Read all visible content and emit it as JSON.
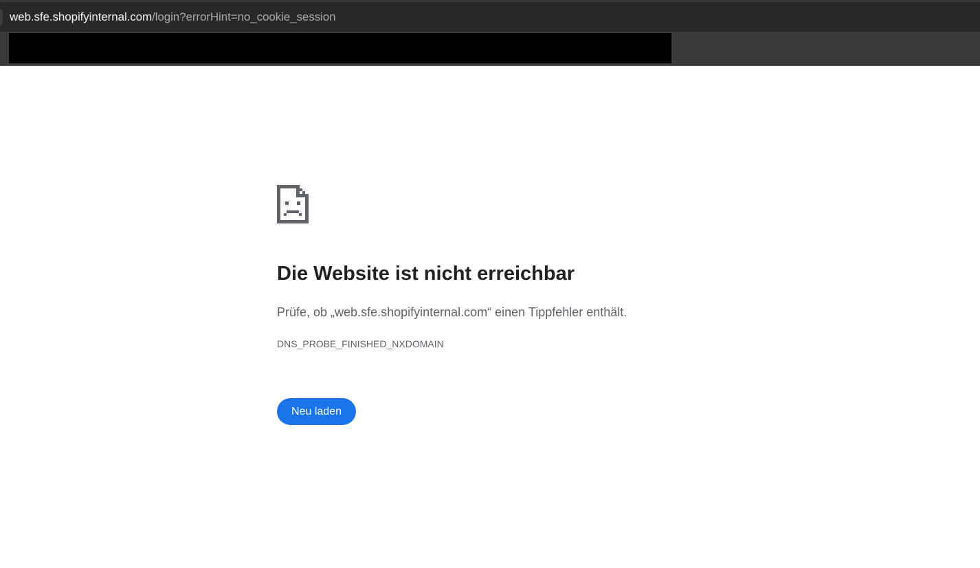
{
  "browser": {
    "url_host": "web.sfe.shopifyinternal.com",
    "url_path": "/login?errorHint=no_cookie_session"
  },
  "error_page": {
    "icon": "sad-page-icon",
    "title": "Die Website ist nicht erreichbar",
    "description": "Prüfe, ob „web.sfe.shopifyinternal.com“ einen Tippfehler enthält.",
    "error_code": "DNS_PROBE_FINISHED_NXDOMAIN",
    "reload_label": "Neu laden",
    "accent_color": "#1a73e8",
    "text_color": "#202124",
    "secondary_text_color": "#5f6368"
  }
}
